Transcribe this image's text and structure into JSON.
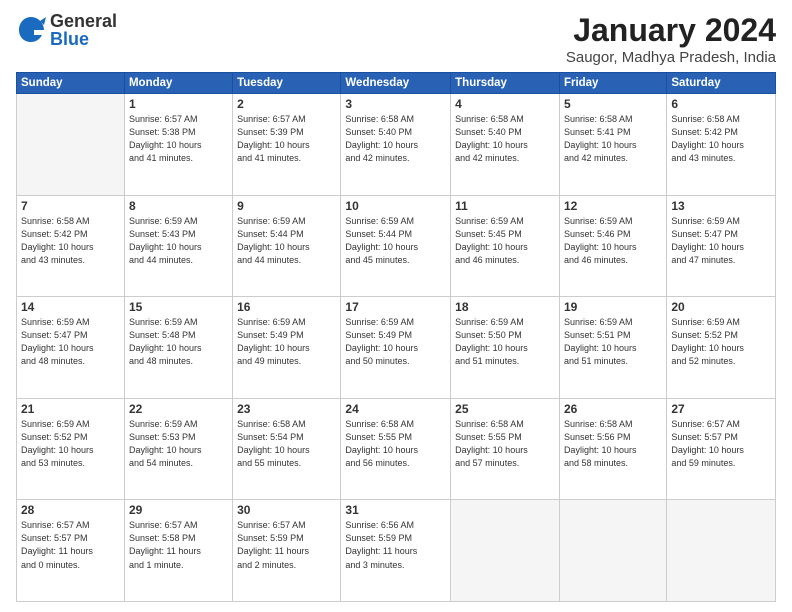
{
  "header": {
    "logo_general": "General",
    "logo_blue": "Blue",
    "title": "January 2024",
    "location": "Saugor, Madhya Pradesh, India"
  },
  "days_of_week": [
    "Sunday",
    "Monday",
    "Tuesday",
    "Wednesday",
    "Thursday",
    "Friday",
    "Saturday"
  ],
  "weeks": [
    [
      {
        "day": "",
        "detail": ""
      },
      {
        "day": "1",
        "detail": "Sunrise: 6:57 AM\nSunset: 5:38 PM\nDaylight: 10 hours\nand 41 minutes."
      },
      {
        "day": "2",
        "detail": "Sunrise: 6:57 AM\nSunset: 5:39 PM\nDaylight: 10 hours\nand 41 minutes."
      },
      {
        "day": "3",
        "detail": "Sunrise: 6:58 AM\nSunset: 5:40 PM\nDaylight: 10 hours\nand 42 minutes."
      },
      {
        "day": "4",
        "detail": "Sunrise: 6:58 AM\nSunset: 5:40 PM\nDaylight: 10 hours\nand 42 minutes."
      },
      {
        "day": "5",
        "detail": "Sunrise: 6:58 AM\nSunset: 5:41 PM\nDaylight: 10 hours\nand 42 minutes."
      },
      {
        "day": "6",
        "detail": "Sunrise: 6:58 AM\nSunset: 5:42 PM\nDaylight: 10 hours\nand 43 minutes."
      }
    ],
    [
      {
        "day": "7",
        "detail": "Sunrise: 6:58 AM\nSunset: 5:42 PM\nDaylight: 10 hours\nand 43 minutes."
      },
      {
        "day": "8",
        "detail": "Sunrise: 6:59 AM\nSunset: 5:43 PM\nDaylight: 10 hours\nand 44 minutes."
      },
      {
        "day": "9",
        "detail": "Sunrise: 6:59 AM\nSunset: 5:44 PM\nDaylight: 10 hours\nand 44 minutes."
      },
      {
        "day": "10",
        "detail": "Sunrise: 6:59 AM\nSunset: 5:44 PM\nDaylight: 10 hours\nand 45 minutes."
      },
      {
        "day": "11",
        "detail": "Sunrise: 6:59 AM\nSunset: 5:45 PM\nDaylight: 10 hours\nand 46 minutes."
      },
      {
        "day": "12",
        "detail": "Sunrise: 6:59 AM\nSunset: 5:46 PM\nDaylight: 10 hours\nand 46 minutes."
      },
      {
        "day": "13",
        "detail": "Sunrise: 6:59 AM\nSunset: 5:47 PM\nDaylight: 10 hours\nand 47 minutes."
      }
    ],
    [
      {
        "day": "14",
        "detail": "Sunrise: 6:59 AM\nSunset: 5:47 PM\nDaylight: 10 hours\nand 48 minutes."
      },
      {
        "day": "15",
        "detail": "Sunrise: 6:59 AM\nSunset: 5:48 PM\nDaylight: 10 hours\nand 48 minutes."
      },
      {
        "day": "16",
        "detail": "Sunrise: 6:59 AM\nSunset: 5:49 PM\nDaylight: 10 hours\nand 49 minutes."
      },
      {
        "day": "17",
        "detail": "Sunrise: 6:59 AM\nSunset: 5:49 PM\nDaylight: 10 hours\nand 50 minutes."
      },
      {
        "day": "18",
        "detail": "Sunrise: 6:59 AM\nSunset: 5:50 PM\nDaylight: 10 hours\nand 51 minutes."
      },
      {
        "day": "19",
        "detail": "Sunrise: 6:59 AM\nSunset: 5:51 PM\nDaylight: 10 hours\nand 51 minutes."
      },
      {
        "day": "20",
        "detail": "Sunrise: 6:59 AM\nSunset: 5:52 PM\nDaylight: 10 hours\nand 52 minutes."
      }
    ],
    [
      {
        "day": "21",
        "detail": "Sunrise: 6:59 AM\nSunset: 5:52 PM\nDaylight: 10 hours\nand 53 minutes."
      },
      {
        "day": "22",
        "detail": "Sunrise: 6:59 AM\nSunset: 5:53 PM\nDaylight: 10 hours\nand 54 minutes."
      },
      {
        "day": "23",
        "detail": "Sunrise: 6:58 AM\nSunset: 5:54 PM\nDaylight: 10 hours\nand 55 minutes."
      },
      {
        "day": "24",
        "detail": "Sunrise: 6:58 AM\nSunset: 5:55 PM\nDaylight: 10 hours\nand 56 minutes."
      },
      {
        "day": "25",
        "detail": "Sunrise: 6:58 AM\nSunset: 5:55 PM\nDaylight: 10 hours\nand 57 minutes."
      },
      {
        "day": "26",
        "detail": "Sunrise: 6:58 AM\nSunset: 5:56 PM\nDaylight: 10 hours\nand 58 minutes."
      },
      {
        "day": "27",
        "detail": "Sunrise: 6:57 AM\nSunset: 5:57 PM\nDaylight: 10 hours\nand 59 minutes."
      }
    ],
    [
      {
        "day": "28",
        "detail": "Sunrise: 6:57 AM\nSunset: 5:57 PM\nDaylight: 11 hours\nand 0 minutes."
      },
      {
        "day": "29",
        "detail": "Sunrise: 6:57 AM\nSunset: 5:58 PM\nDaylight: 11 hours\nand 1 minute."
      },
      {
        "day": "30",
        "detail": "Sunrise: 6:57 AM\nSunset: 5:59 PM\nDaylight: 11 hours\nand 2 minutes."
      },
      {
        "day": "31",
        "detail": "Sunrise: 6:56 AM\nSunset: 5:59 PM\nDaylight: 11 hours\nand 3 minutes."
      },
      {
        "day": "",
        "detail": ""
      },
      {
        "day": "",
        "detail": ""
      },
      {
        "day": "",
        "detail": ""
      }
    ]
  ]
}
